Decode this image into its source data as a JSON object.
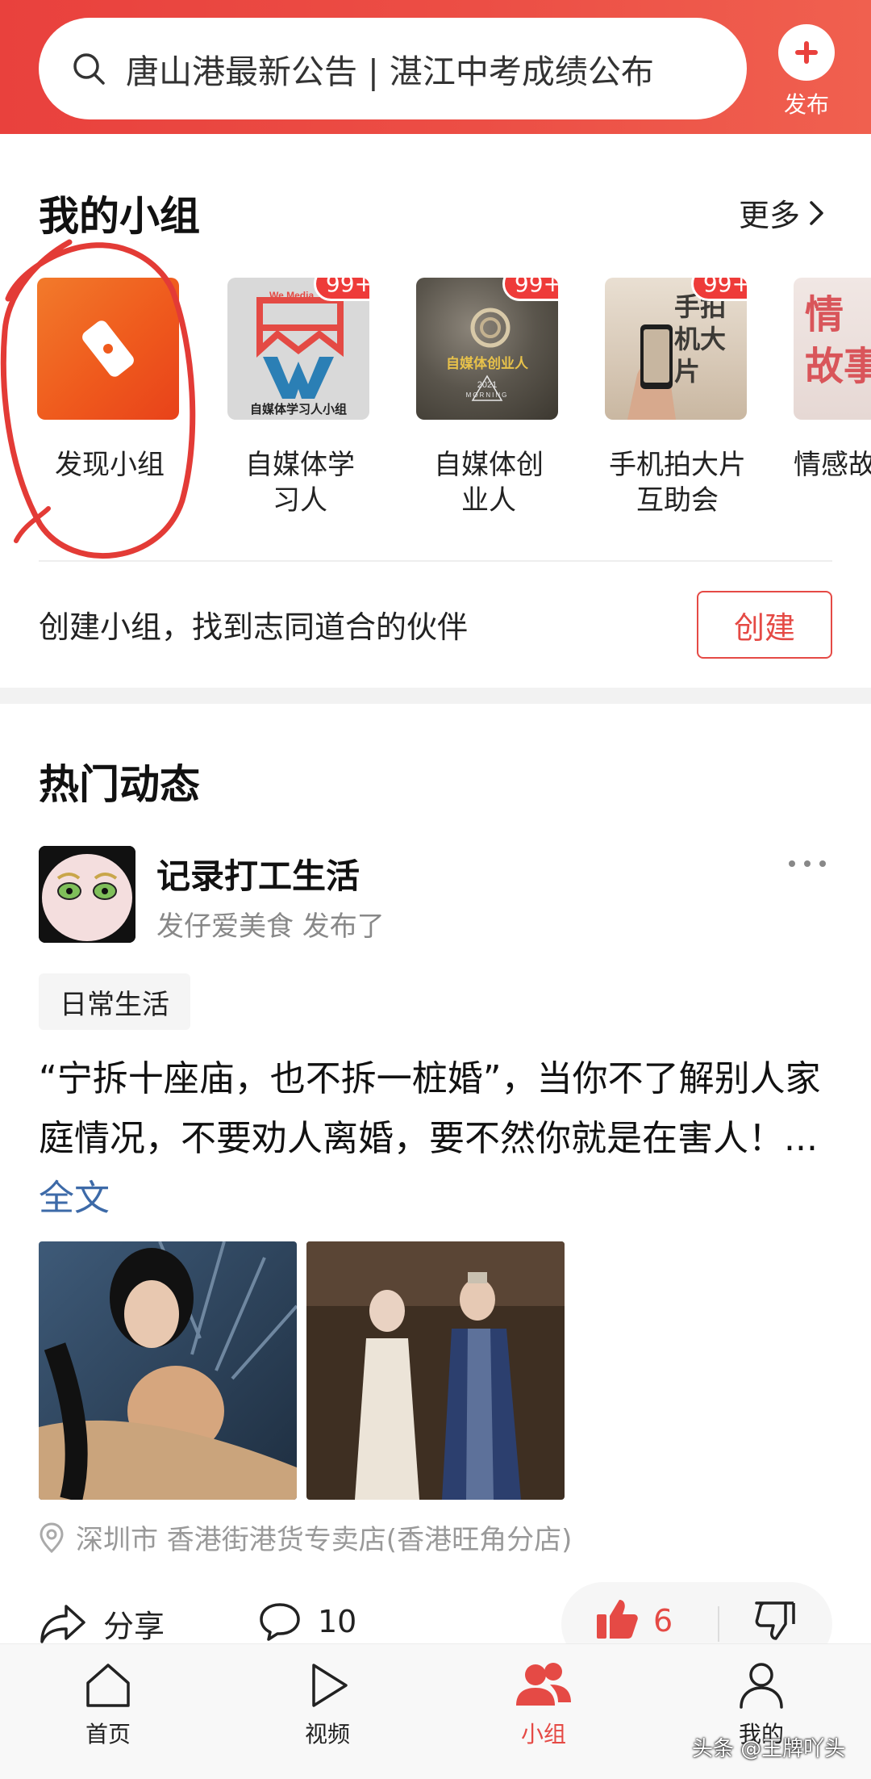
{
  "search": {
    "text": "唐山港最新公告 | 湛江中考成绩公布"
  },
  "publish": {
    "label": "发布"
  },
  "my_groups": {
    "title": "我的小组",
    "more_label": "更多",
    "items": [
      {
        "name": "发现小组",
        "badge": ""
      },
      {
        "name": "自媒体学\n习人",
        "badge": "99+",
        "thumb_text": "自媒体学习人小组",
        "thumb_brand": "We Media"
      },
      {
        "name": "自媒体创\n业人",
        "badge": "99+",
        "thumb_text": "自媒体创业人",
        "thumb_sub": "2021",
        "thumb_sub2": "MORNING"
      },
      {
        "name": "手机拍大片\n互助会",
        "badge": "99+",
        "thumb_text": "手拍\n机大\n片"
      },
      {
        "name": "情感故",
        "badge": "",
        "thumb_text": "情\n故事"
      }
    ],
    "create_text": "创建小组，找到志同道合的伙伴",
    "create_button": "创建"
  },
  "feed": {
    "title": "热门动态",
    "post": {
      "group_name": "记录打工生活",
      "meta": "发仔爱美食  发布了",
      "tag": "日常生活",
      "text": "“宁拆十座庙，也不拆一桩婚”，当你不了解别人家庭情况，不要劝人离婚，要不然你就是在害人！...",
      "full_link": "全文",
      "location": "深圳市  香港街港货专卖店(香港旺角分店)",
      "share_label": "分享",
      "comments": "10",
      "likes": "6"
    }
  },
  "nav": {
    "items": [
      {
        "label": "首页"
      },
      {
        "label": "视频"
      },
      {
        "label": "小组"
      },
      {
        "label": "我的"
      }
    ]
  },
  "watermark": "头条 @王牌吖头",
  "colors": {
    "brand_red": "#e9413d",
    "accent": "#e54a45",
    "link": "#3d6aa8"
  }
}
